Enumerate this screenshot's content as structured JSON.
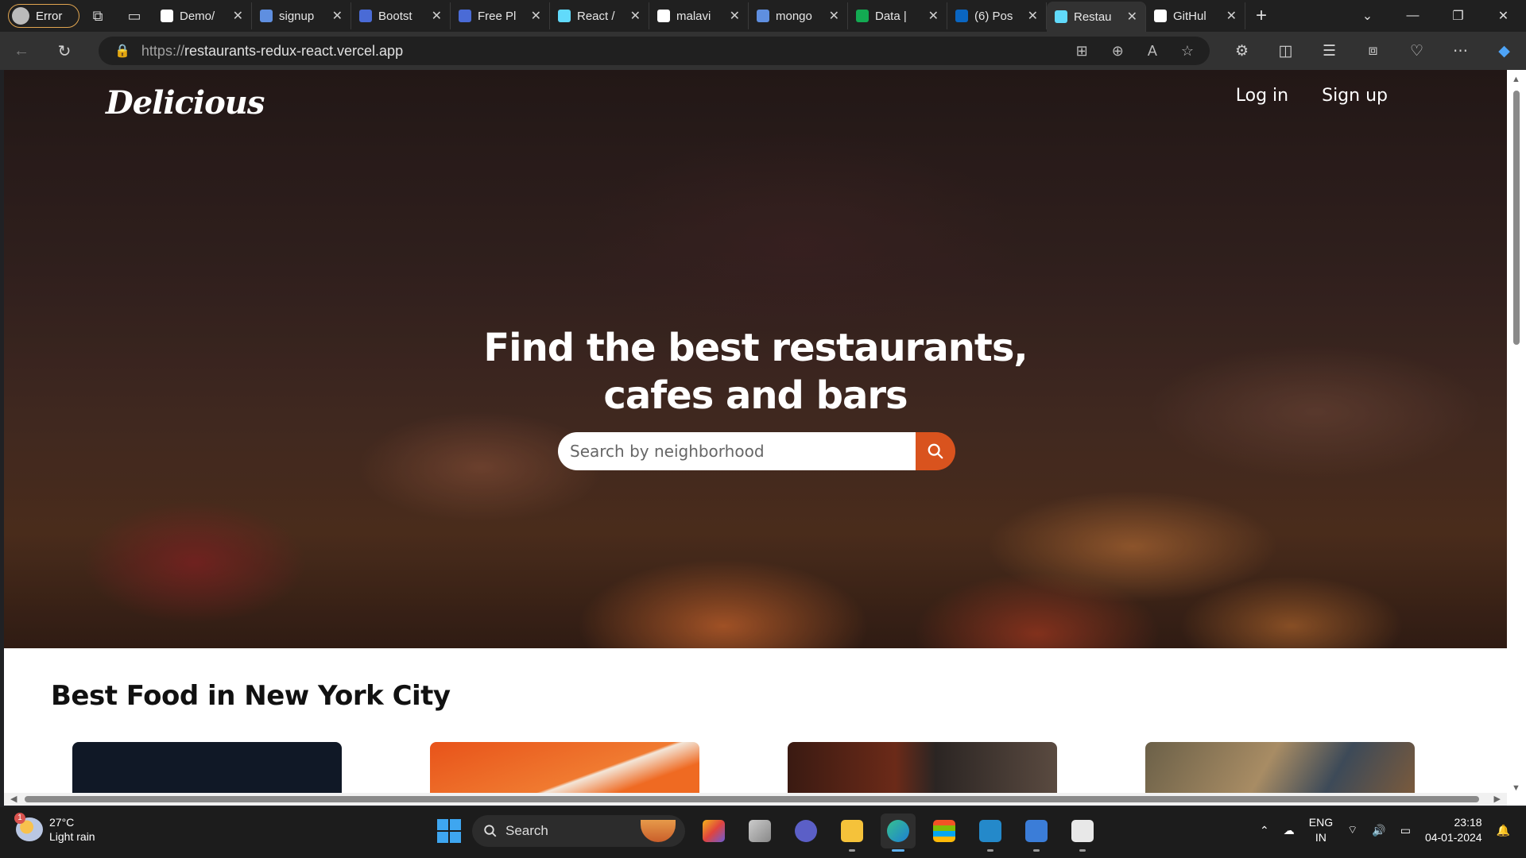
{
  "browser": {
    "profile_label": "Error",
    "tabs": [
      {
        "title": "Demo/",
        "color": "#ffffff"
      },
      {
        "title": "signup",
        "color": "#5f8fe0"
      },
      {
        "title": "Bootst",
        "color": "#4a6bd6"
      },
      {
        "title": "Free Pl",
        "color": "#4a6bd6"
      },
      {
        "title": "React /",
        "color": "#61dafb"
      },
      {
        "title": "malavi",
        "color": "#ffffff"
      },
      {
        "title": "mongo",
        "color": "#5f8fe0"
      },
      {
        "title": "Data |",
        "color": "#13aa52"
      },
      {
        "title": "(6) Pos",
        "color": "#0a66c2"
      },
      {
        "title": "Restau",
        "color": "#61dafb",
        "active": true
      },
      {
        "title": "GitHul",
        "color": "#ffffff"
      }
    ],
    "url_protocol": "https://",
    "url_host": "restaurants-redux-react.vercel.app"
  },
  "page": {
    "logo": "Delicious",
    "login": "Log in",
    "signup": "Sign up",
    "hero_line1": "Find the best restaurants,",
    "hero_line2": "cafes and bars",
    "search_placeholder": "Search by neighborhood",
    "section_title": "Best Food in New York City",
    "accent": "#d9531e"
  },
  "taskbar": {
    "temperature": "27°C",
    "weather": "Light rain",
    "weather_badge": "1",
    "search_label": "Search",
    "lang_line1": "ENG",
    "lang_line2": "IN",
    "time": "23:18",
    "date": "04-01-2024"
  }
}
